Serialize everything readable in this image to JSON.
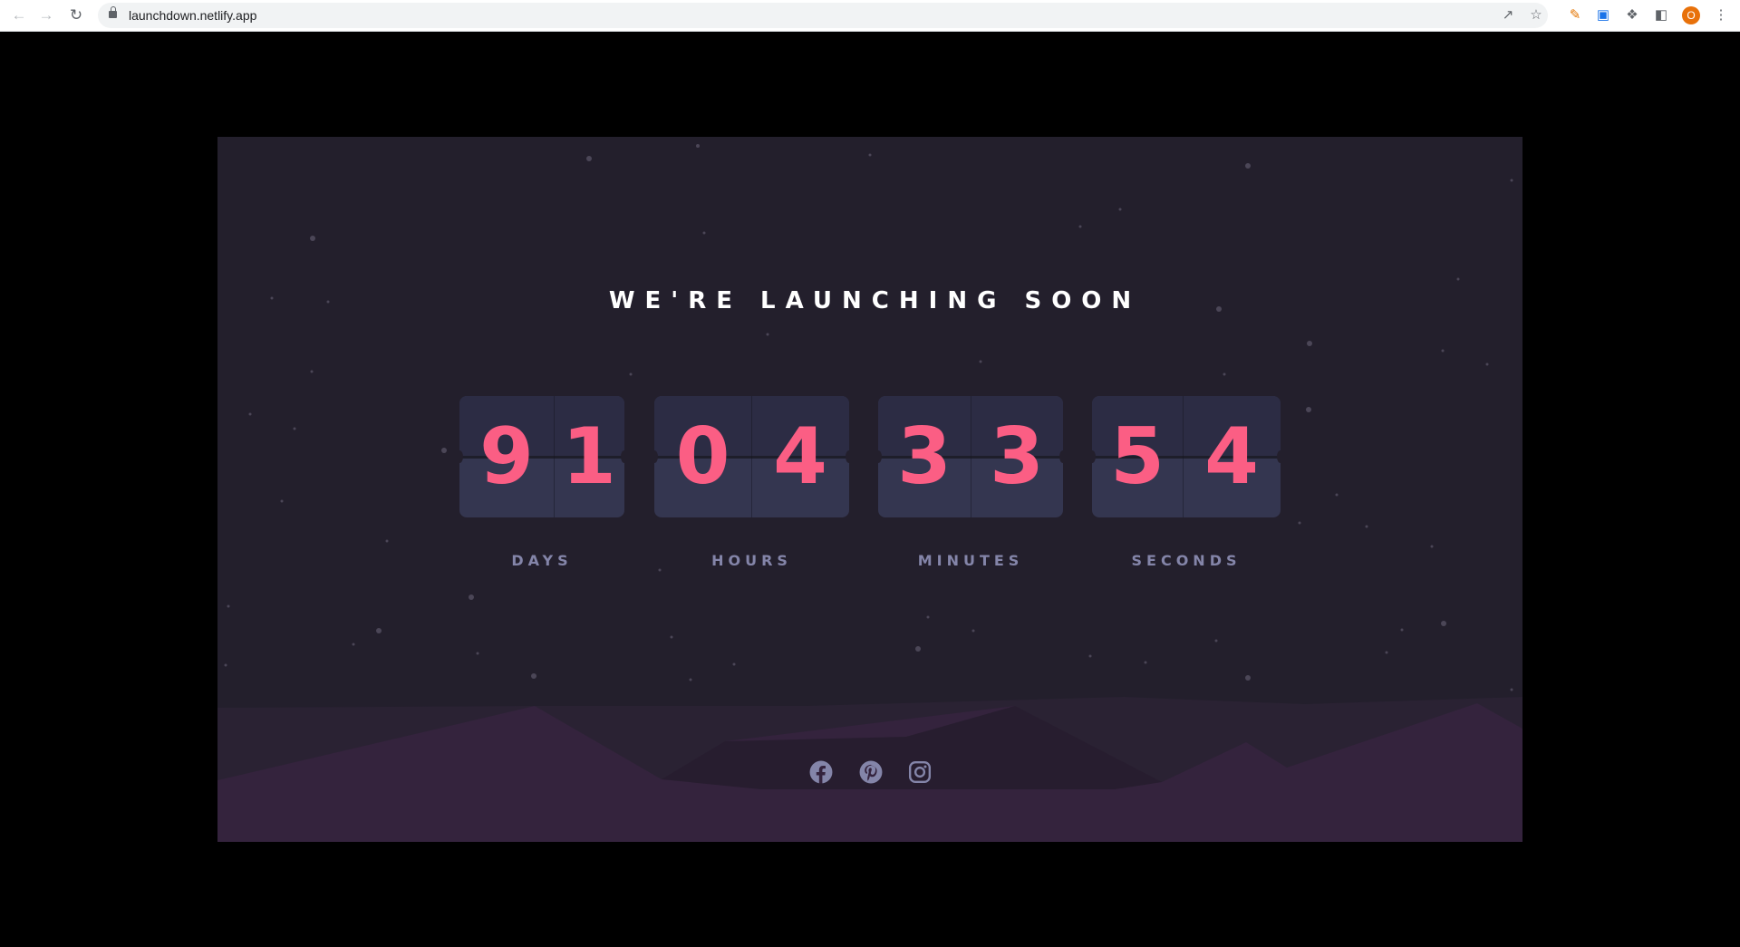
{
  "browser": {
    "url": "launchdown.netlify.app",
    "profile_initial": "O"
  },
  "page": {
    "headline": "WE'RE LAUNCHING SOON",
    "countdown": [
      {
        "id": "days",
        "label": "DAYS",
        "digits": [
          "9",
          "1"
        ]
      },
      {
        "id": "hours",
        "label": "HOURS",
        "digits": [
          "0",
          "4"
        ]
      },
      {
        "id": "minutes",
        "label": "MINUTES",
        "digits": [
          "3",
          "3"
        ]
      },
      {
        "id": "seconds",
        "label": "SECONDS",
        "digits": [
          "5",
          "4"
        ]
      }
    ],
    "social": [
      "facebook-icon",
      "pinterest-icon",
      "instagram-icon"
    ]
  },
  "colors": {
    "background": "#231f2c",
    "card_top": "#2c2c44",
    "card_bottom": "#343650",
    "digit": "#fb5e84",
    "label": "#8485a9",
    "hills": "#34233d"
  }
}
